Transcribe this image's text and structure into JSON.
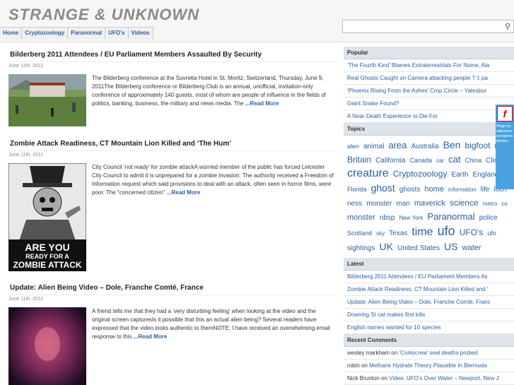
{
  "site": {
    "title": "STRANGE & UNKNOWN"
  },
  "nav": [
    "Home",
    "Cryptozoology",
    "Paranormal",
    "UFO's",
    "Videos"
  ],
  "posts": [
    {
      "title": "Bilderberg 2011 Attendees / EU Parliament Members Assaulted By Security",
      "date": "June 11th, 2011",
      "excerpt": "The Bilderberg conference at the Suvretta Hotel in St. Moritz, Switzerland, Thursday, June 9, 2011The Bilderberg conference or Bilderberg Club is an annual, unofficial, invitation-only conference of approximately 140 guests, most of whom are people of influence in the fields of politics, banking, business, the military and news media. The",
      "more": "...Read More"
    },
    {
      "title": "Zombie Attack Readiness, CT Mountain Lion Killed and ‘The Hum’",
      "date": "June 11th, 2011",
      "excerpt": " City Council ‘not ready’ for zombie attackA worried member of the public has forced Leicester City Council to admit it is unprepared for a zombie invasion. The authority received a Freedom of Information request which said provisions to deal with an attack, often seen in horror films, were poor. The “concerned citizen”",
      "more": "...Read More",
      "poster": {
        "line1": "ARE YOU",
        "line2": "READY FOR A",
        "line3": "ZOMBIE ATTACK"
      }
    },
    {
      "title": "Update: Alien Being Video – Dole, Franche Comté, France",
      "date": "June 11th, 2011",
      "excerpt": "A friend tells me that they had a ‘very disturbing feeling’ when looking at the video and the original screen capturesIs it possible that this an actual alien being? Several readers have expressed that the video looks authentic to themNOTE: I have received an overwhelming email response to this",
      "more": "...Read More"
    }
  ],
  "sidebar": {
    "popular": {
      "heading": "Popular",
      "items": [
        "‘The Fourth Kind’ Blames Extraterrestrials For Nome, Ala",
        "Real Ghosts Caught on Camera attacking people ? ‡ pa",
        "‘Phoenix Rising From the Ashes’ Crop Circle – Yatesbur",
        "Giant Snake Found?",
        "A Near-Death Experience to Die For"
      ]
    },
    "topics": {
      "heading": "Topics",
      "tags": [
        {
          "t": "alien",
          "s": 8
        },
        {
          "t": "animal",
          "s": 10
        },
        {
          "t": "area",
          "s": 13
        },
        {
          "t": "Australia",
          "s": 10
        },
        {
          "t": "Ben",
          "s": 14
        },
        {
          "t": "bigfoot",
          "s": 12
        },
        {
          "t": "bird",
          "s": 8
        },
        {
          "t": "Britain",
          "s": 12
        },
        {
          "t": "California",
          "s": 10
        },
        {
          "t": "Canada",
          "s": 9
        },
        {
          "t": "car",
          "s": 8
        },
        {
          "t": "cat",
          "s": 13
        },
        {
          "t": "China",
          "s": 9
        },
        {
          "t": "Click",
          "s": 10
        },
        {
          "t": "creature",
          "s": 16
        },
        {
          "t": "Cryptozoology",
          "s": 12
        },
        {
          "t": "Earth",
          "s": 10
        },
        {
          "t": "England",
          "s": 10
        },
        {
          "t": "E",
          "s": 9
        },
        {
          "t": "Florida",
          "s": 9
        },
        {
          "t": "ghost",
          "s": 14
        },
        {
          "t": "ghosts",
          "s": 10
        },
        {
          "t": "home",
          "s": 11
        },
        {
          "t": "information",
          "s": 8
        },
        {
          "t": "life",
          "s": 10
        },
        {
          "t": "loch",
          "s": 10
        },
        {
          "t": "ness",
          "s": 10
        },
        {
          "t": "monster",
          "s": 10
        },
        {
          "t": "man",
          "s": 10
        },
        {
          "t": "maverick",
          "s": 11
        },
        {
          "t": "science",
          "s": 12
        },
        {
          "t": "metro",
          "s": 8
        },
        {
          "t": "co",
          "s": 8
        },
        {
          "t": "monster",
          "s": 11
        },
        {
          "t": "nbsp",
          "s": 10
        },
        {
          "t": "New York",
          "s": 8
        },
        {
          "t": "Paranormal",
          "s": 13
        },
        {
          "t": "police",
          "s": 10
        },
        {
          "t": "Scotland",
          "s": 9
        },
        {
          "t": "sky",
          "s": 8
        },
        {
          "t": "Texas",
          "s": 10
        },
        {
          "t": "time",
          "s": 16
        },
        {
          "t": "ufo",
          "s": 18
        },
        {
          "t": "UFO's",
          "s": 12
        },
        {
          "t": "ufo",
          "s": 9
        },
        {
          "t": "sightings",
          "s": 10
        },
        {
          "t": "UK",
          "s": 14
        },
        {
          "t": "United States",
          "s": 10
        },
        {
          "t": "US",
          "s": 14
        },
        {
          "t": "water",
          "s": 11
        }
      ]
    },
    "latest": {
      "heading": "Latest",
      "items": [
        "Bilderberg 2011 Attendees / EU Parliament Members As",
        "Zombie Attack Readiness, CT Mountain Lion Killed and ‘",
        "Update: Alien Being Video – Dole, Franche Comté, Franc",
        "Downing St cat makes first kills",
        "English names wanted for 10 species"
      ]
    },
    "comments": {
      "heading": "Recent Comments",
      "items": [
        {
          "author": "wesley markham",
          "on": "on",
          "post": "‘Corkscrew’ seal deaths probed"
        },
        {
          "author": "robin",
          "on": "on",
          "post": "Methane Hydrate Theory Plausible In Bermuda"
        },
        {
          "author": "Nick Brunton",
          "on": "on",
          "post": "Video: UFO’s Over Water – Newport, New J"
        }
      ]
    }
  },
  "flash": {
    "text": "Plugin by wpbureau wordpress themes"
  }
}
